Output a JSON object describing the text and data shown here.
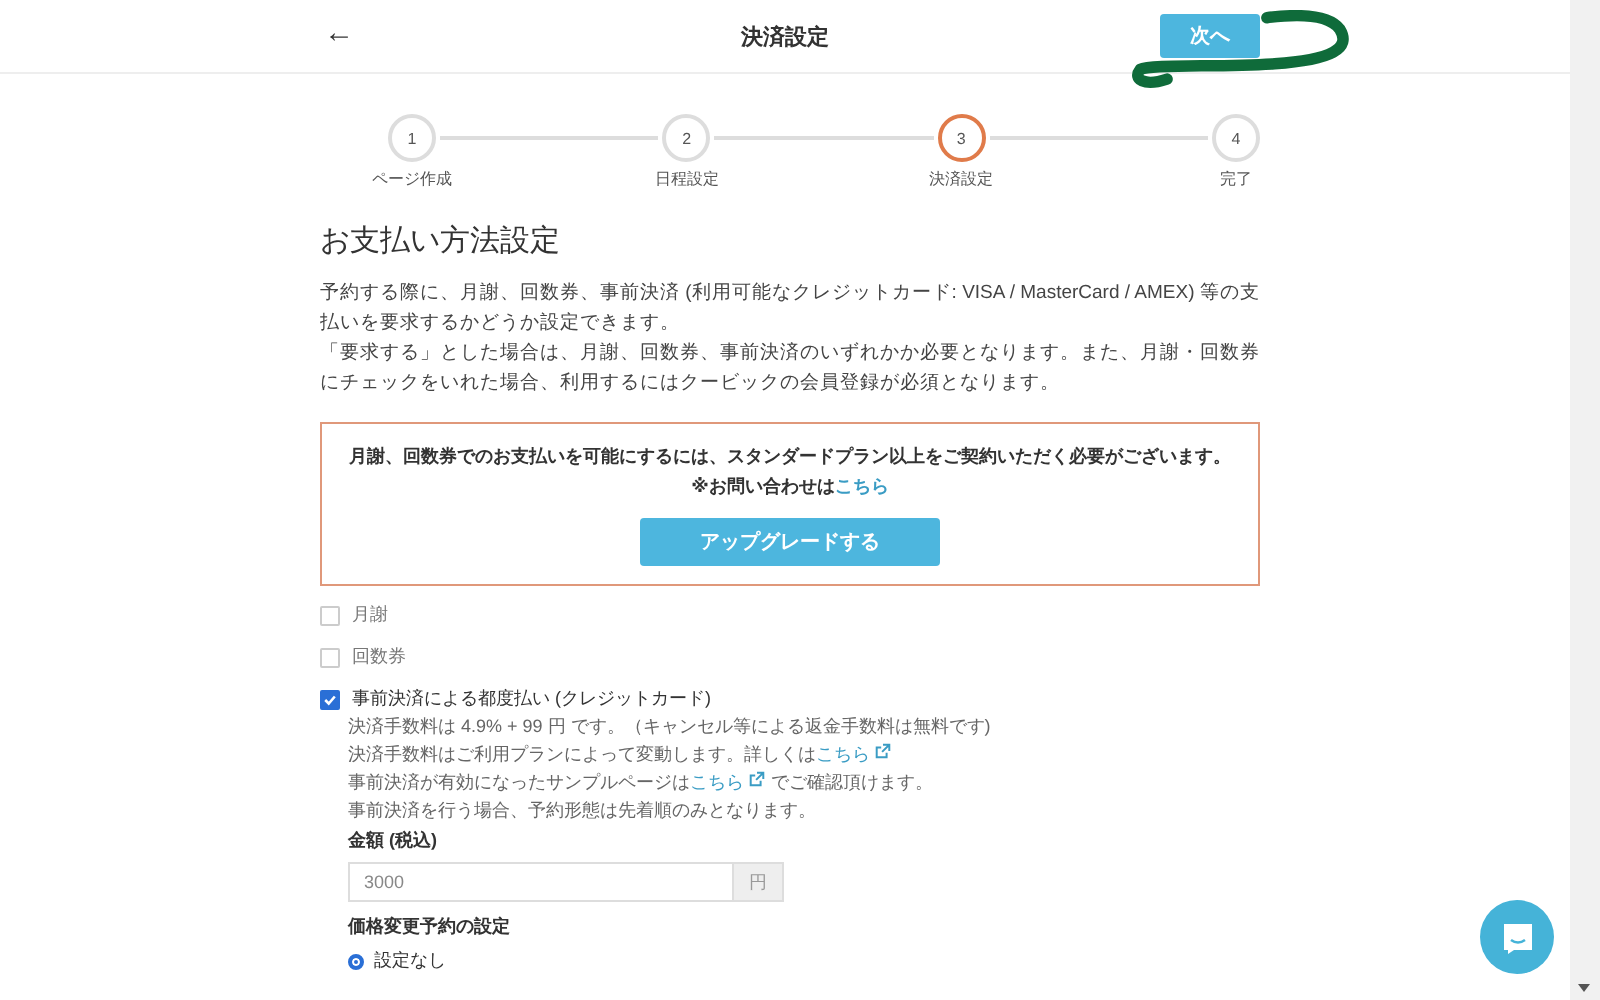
{
  "header": {
    "back": "←",
    "title": "決済設定",
    "next": "次へ"
  },
  "steps": [
    {
      "number": "1",
      "label": "ページ作成",
      "selected": false
    },
    {
      "number": "2",
      "label": "日程設定",
      "selected": false
    },
    {
      "number": "3",
      "label": "決済設定",
      "selected": true
    },
    {
      "number": "4",
      "label": "完了",
      "selected": false
    }
  ],
  "section_title": "お支払い方法設定",
  "description": [
    "予約する際に、月謝、回数券、事前決済 (利用可能なクレジットカード: VISA / MasterCard / AMEX) 等の支払いを要求するかどうか設定できます。",
    "「要求する」とした場合は、月謝、回数券、事前決済のいずれかか必要となります。また、月謝・回数券にチェックをいれた場合、利用するにはクービックの会員登録が必須となります。"
  ],
  "notice": {
    "text": "月謝、回数券でのお支払いを可能にするには、スタンダードプラン以上をご契約いただく必要がございます。※お問い合わせは",
    "link": "こちら",
    "button": "アップグレードする"
  },
  "options": [
    {
      "label": "月謝",
      "checked": false
    },
    {
      "label": "回数券",
      "checked": false
    },
    {
      "label": "事前決済による都度払い (クレジットカード)",
      "checked": true,
      "details": [
        {
          "text": "決済手数料は 4.9% + 99 円 です。（キャンセル等による返金手数料は無料です)"
        },
        {
          "text": "決済手数料はご利用プランによって変動します。詳しくは",
          "link": "こちら"
        },
        {
          "text": "事前決済が有効になったサンプルページは",
          "link": "こちら",
          "after": " でご確認頂けます。"
        },
        {
          "text": "事前決済を行う場合、予約形態は先着順のみとなります。"
        }
      ]
    }
  ],
  "price": {
    "label": "金額 (税込)",
    "value": "3000",
    "unit": "円"
  },
  "price_change": {
    "label": "価格変更予約の設定",
    "options": [
      {
        "label": "設定なし",
        "selected": true
      }
    ]
  }
}
